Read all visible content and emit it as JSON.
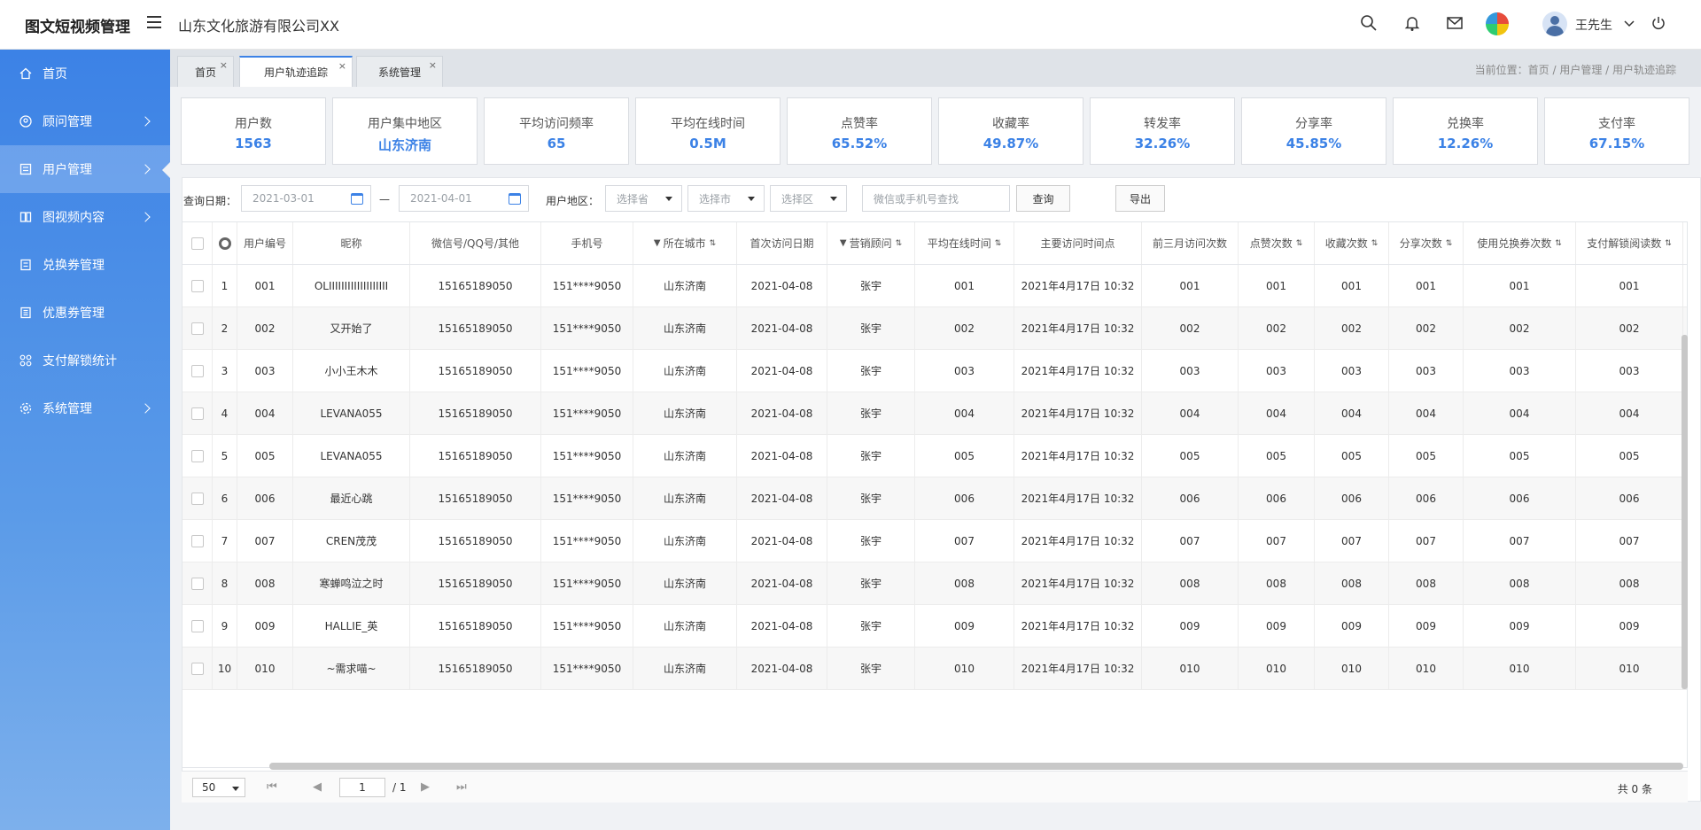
{
  "header": {
    "brand": "图文短视频管理",
    "company": "山东文化旅游有限公司XX",
    "user_name": "王先生"
  },
  "sidebar": {
    "items": [
      {
        "label": "首页",
        "icon": "home-icon",
        "has_arrow": false,
        "active": false
      },
      {
        "label": "顾问管理",
        "icon": "advisor-icon",
        "has_arrow": true,
        "active": false
      },
      {
        "label": "用户管理",
        "icon": "user-manage-icon",
        "has_arrow": true,
        "active": true
      },
      {
        "label": "图视频内容",
        "icon": "media-icon",
        "has_arrow": true,
        "active": false
      },
      {
        "label": "兑换券管理",
        "icon": "voucher-icon",
        "has_arrow": false,
        "active": false
      },
      {
        "label": "优惠券管理",
        "icon": "coupon-icon",
        "has_arrow": false,
        "active": false
      },
      {
        "label": "支付解锁统计",
        "icon": "stats-icon",
        "has_arrow": false,
        "active": false
      },
      {
        "label": "系统管理",
        "icon": "settings-icon",
        "has_arrow": true,
        "active": false
      }
    ]
  },
  "tabs": [
    {
      "label": "首页",
      "active": false
    },
    {
      "label": "用户轨迹追踪",
      "active": true
    },
    {
      "label": "系统管理",
      "active": false
    }
  ],
  "breadcrumb": "当前位置：首页 / 用户管理 / 用户轨迹追踪",
  "stats": [
    {
      "title": "用户数",
      "value": "1563"
    },
    {
      "title": "用户集中地区",
      "value": "山东济南"
    },
    {
      "title": "平均访问频率",
      "value": "65"
    },
    {
      "title": "平均在线时间",
      "value": "0.5M"
    },
    {
      "title": "点赞率",
      "value": "65.52%"
    },
    {
      "title": "收藏率",
      "value": "49.87%"
    },
    {
      "title": "转发率",
      "value": "32.26%"
    },
    {
      "title": "分享率",
      "value": "45.85%"
    },
    {
      "title": "兑换率",
      "value": "12.26%"
    },
    {
      "title": "支付率",
      "value": "67.15%"
    }
  ],
  "filters": {
    "date_label": "查询日期：",
    "date_start": "2021-03-01",
    "date_sep": "—",
    "date_end": "2021-04-01",
    "region_label": "用户地区：",
    "province_placeholder": "选择省",
    "city_placeholder": "选择市",
    "district_placeholder": "选择区",
    "search_placeholder": "微信或手机号查找",
    "query_button": "查询",
    "export_button": "导出"
  },
  "table": {
    "columns": [
      "用户编号",
      "昵称",
      "微信号/QQ号/其他",
      "手机号",
      "所在城市",
      "首次访问日期",
      "营销顾问",
      "平均在线时间",
      "主要访问时间点",
      "前三月访问次数",
      "点赞次数",
      "收藏次数",
      "分享次数",
      "使用兑换券次数",
      "支付解锁阅读数"
    ],
    "rows": [
      {
        "idx": "1",
        "id": "001",
        "nick": "OLIIIIIIIIIIIIIIIIIII",
        "wx": "15165189050",
        "phone": "151****9050",
        "city": "山东济南",
        "first": "2021-04-08",
        "advisor": "张宇",
        "avg": "001",
        "time": "2021年4月17日 10:32",
        "visits": "001",
        "likes": "001",
        "favs": "001",
        "shares": "001",
        "vouchers": "001",
        "paid": "001"
      },
      {
        "idx": "2",
        "id": "002",
        "nick": "又开始了",
        "wx": "15165189050",
        "phone": "151****9050",
        "city": "山东济南",
        "first": "2021-04-08",
        "advisor": "张宇",
        "avg": "002",
        "time": "2021年4月17日 10:32",
        "visits": "002",
        "likes": "002",
        "favs": "002",
        "shares": "002",
        "vouchers": "002",
        "paid": "002"
      },
      {
        "idx": "3",
        "id": "003",
        "nick": "小小王木木",
        "wx": "15165189050",
        "phone": "151****9050",
        "city": "山东济南",
        "first": "2021-04-08",
        "advisor": "张宇",
        "avg": "003",
        "time": "2021年4月17日 10:32",
        "visits": "003",
        "likes": "003",
        "favs": "003",
        "shares": "003",
        "vouchers": "003",
        "paid": "003"
      },
      {
        "idx": "4",
        "id": "004",
        "nick": "LEVANA055",
        "wx": "15165189050",
        "phone": "151****9050",
        "city": "山东济南",
        "first": "2021-04-08",
        "advisor": "张宇",
        "avg": "004",
        "time": "2021年4月17日 10:32",
        "visits": "004",
        "likes": "004",
        "favs": "004",
        "shares": "004",
        "vouchers": "004",
        "paid": "004"
      },
      {
        "idx": "5",
        "id": "005",
        "nick": "LEVANA055",
        "wx": "15165189050",
        "phone": "151****9050",
        "city": "山东济南",
        "first": "2021-04-08",
        "advisor": "张宇",
        "avg": "005",
        "time": "2021年4月17日 10:32",
        "visits": "005",
        "likes": "005",
        "favs": "005",
        "shares": "005",
        "vouchers": "005",
        "paid": "005"
      },
      {
        "idx": "6",
        "id": "006",
        "nick": "最近心跳",
        "wx": "15165189050",
        "phone": "151****9050",
        "city": "山东济南",
        "first": "2021-04-08",
        "advisor": "张宇",
        "avg": "006",
        "time": "2021年4月17日 10:32",
        "visits": "006",
        "likes": "006",
        "favs": "006",
        "shares": "006",
        "vouchers": "006",
        "paid": "006"
      },
      {
        "idx": "7",
        "id": "007",
        "nick": "CREN茂茂",
        "wx": "15165189050",
        "phone": "151****9050",
        "city": "山东济南",
        "first": "2021-04-08",
        "advisor": "张宇",
        "avg": "007",
        "time": "2021年4月17日 10:32",
        "visits": "007",
        "likes": "007",
        "favs": "007",
        "shares": "007",
        "vouchers": "007",
        "paid": "007"
      },
      {
        "idx": "8",
        "id": "008",
        "nick": "寒蝉鸣泣之时",
        "wx": "15165189050",
        "phone": "151****9050",
        "city": "山东济南",
        "first": "2021-04-08",
        "advisor": "张宇",
        "avg": "008",
        "time": "2021年4月17日 10:32",
        "visits": "008",
        "likes": "008",
        "favs": "008",
        "shares": "008",
        "vouchers": "008",
        "paid": "008"
      },
      {
        "idx": "9",
        "id": "009",
        "nick": "HALLIE_英",
        "wx": "15165189050",
        "phone": "151****9050",
        "city": "山东济南",
        "first": "2021-04-08",
        "advisor": "张宇",
        "avg": "009",
        "time": "2021年4月17日 10:32",
        "visits": "009",
        "likes": "009",
        "favs": "009",
        "shares": "009",
        "vouchers": "009",
        "paid": "009"
      },
      {
        "idx": "10",
        "id": "010",
        "nick": "~需求喵~",
        "wx": "15165189050",
        "phone": "151****9050",
        "city": "山东济南",
        "first": "2021-04-08",
        "advisor": "张宇",
        "avg": "010",
        "time": "2021年4月17日 10:32",
        "visits": "010",
        "likes": "010",
        "favs": "010",
        "shares": "010",
        "vouchers": "010",
        "paid": "010"
      }
    ]
  },
  "pager": {
    "page_size": "50",
    "current_page": "1",
    "total_pages": "/ 1",
    "total_count": "共 0 条"
  },
  "colors": {
    "primary": "#3c82e6",
    "sidebar_top": "#3c82e6",
    "sidebar_bottom": "#7db0ec"
  }
}
